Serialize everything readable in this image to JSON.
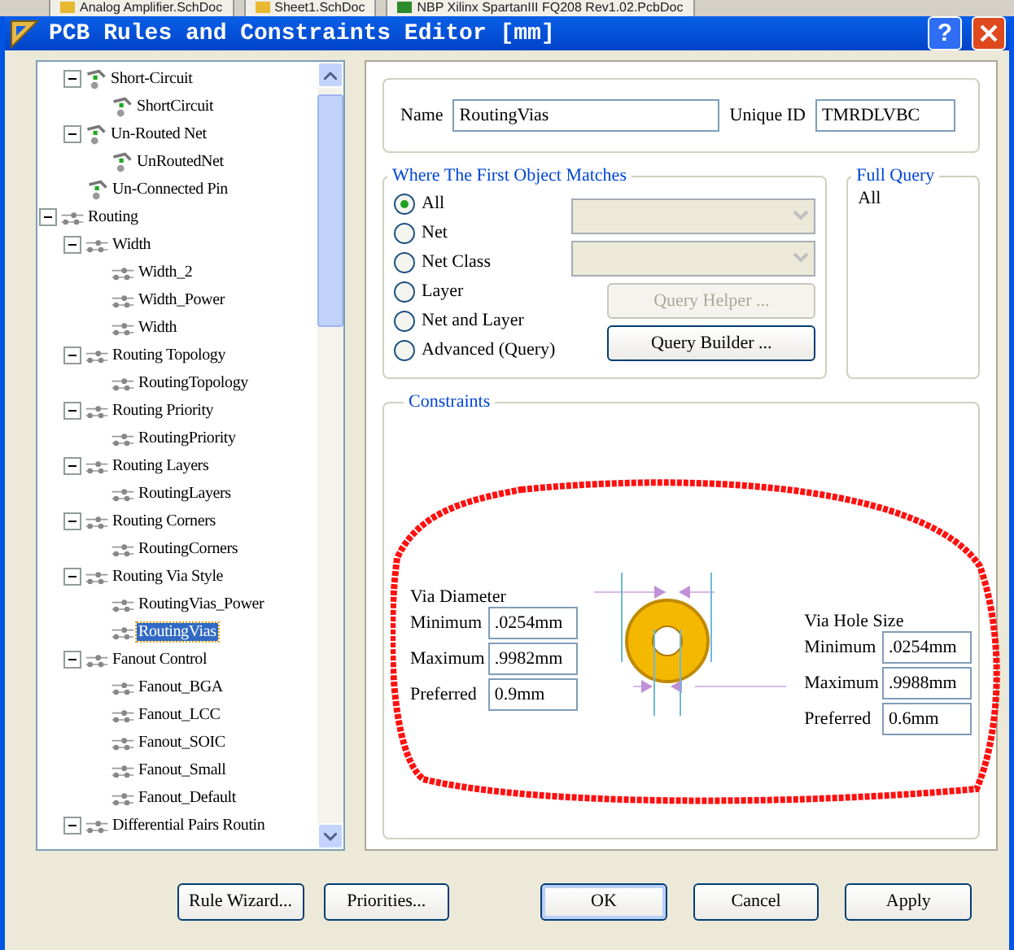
{
  "background_tabs": [
    {
      "label": "Analog Amplifier.SchDoc",
      "kind": "schematic"
    },
    {
      "label": "Sheet1.SchDoc",
      "kind": "schematic"
    },
    {
      "label": "NBP Xilinx SpartanIII FQ208 Rev1.02.PcbDoc",
      "kind": "pcb"
    }
  ],
  "window": {
    "title": "PCB Rules and Constraints Editor [mm]",
    "help": "?"
  },
  "tree": {
    "scrolled_group": [
      {
        "label": "Short-Circuit",
        "kind": "electrical",
        "expanded": true,
        "selected": false,
        "children": [
          {
            "label": "ShortCircuit",
            "kind": "electrical",
            "selected": false
          }
        ]
      },
      {
        "label": "Un-Routed Net",
        "kind": "electrical",
        "expanded": true,
        "selected": false,
        "children": [
          {
            "label": "UnRoutedNet",
            "kind": "electrical",
            "selected": false
          }
        ]
      },
      {
        "label": "Un-Connected Pin",
        "kind": "electrical",
        "selected": false
      }
    ],
    "items": [
      {
        "label": "Routing",
        "kind": "routing",
        "expanded": true,
        "selected": false,
        "children": [
          {
            "label": "Width",
            "kind": "routing",
            "expanded": true,
            "selected": false,
            "children": [
              {
                "label": "Width_2",
                "kind": "routing",
                "selected": false
              },
              {
                "label": "Width_Power",
                "kind": "routing",
                "selected": false
              },
              {
                "label": "Width",
                "kind": "routing",
                "selected": false
              }
            ]
          },
          {
            "label": "Routing Topology",
            "kind": "routing",
            "expanded": true,
            "selected": false,
            "children": [
              {
                "label": "RoutingTopology",
                "kind": "routing",
                "selected": false
              }
            ]
          },
          {
            "label": "Routing Priority",
            "kind": "routing",
            "expanded": true,
            "selected": false,
            "children": [
              {
                "label": "RoutingPriority",
                "kind": "routing",
                "selected": false
              }
            ]
          },
          {
            "label": "Routing Layers",
            "kind": "routing",
            "expanded": true,
            "selected": false,
            "children": [
              {
                "label": "RoutingLayers",
                "kind": "routing",
                "selected": false
              }
            ]
          },
          {
            "label": "Routing Corners",
            "kind": "routing",
            "expanded": true,
            "selected": false,
            "children": [
              {
                "label": "RoutingCorners",
                "kind": "routing",
                "selected": false
              }
            ]
          },
          {
            "label": "Routing Via Style",
            "kind": "routing",
            "expanded": true,
            "selected": false,
            "children": [
              {
                "label": "RoutingVias_Power",
                "kind": "routing",
                "selected": false
              },
              {
                "label": "RoutingVias",
                "kind": "routing",
                "selected": true
              }
            ]
          },
          {
            "label": "Fanout Control",
            "kind": "routing",
            "expanded": true,
            "selected": false,
            "children": [
              {
                "label": "Fanout_BGA",
                "kind": "routing",
                "selected": false
              },
              {
                "label": "Fanout_LCC",
                "kind": "routing",
                "selected": false
              },
              {
                "label": "Fanout_SOIC",
                "kind": "routing",
                "selected": false
              },
              {
                "label": "Fanout_Small",
                "kind": "routing",
                "selected": false
              },
              {
                "label": "Fanout_Default",
                "kind": "routing",
                "selected": false
              }
            ]
          },
          {
            "label": "Differential Pairs Routin",
            "kind": "routing",
            "expanded": true,
            "selected": false
          }
        ]
      }
    ]
  },
  "rule": {
    "name_label": "Name",
    "name": "RoutingVias",
    "id_label": "Unique ID",
    "id": "TMRDLVBC"
  },
  "match": {
    "title": "Where The First Object Matches",
    "options": [
      {
        "label": "All",
        "selected": true
      },
      {
        "label": "Net",
        "selected": false
      },
      {
        "label": "Net Class",
        "selected": false
      },
      {
        "label": "Layer",
        "selected": false
      },
      {
        "label": "Net and Layer",
        "selected": false
      },
      {
        "label": "Advanced (Query)",
        "selected": false
      }
    ],
    "query_helper": {
      "label": "Query Helper ...",
      "disabled": true
    },
    "query_builder": {
      "label": "Query Builder ...",
      "disabled": false
    }
  },
  "full_query": {
    "title": "Full Query",
    "text": "All"
  },
  "constraints": {
    "title": "Constraints",
    "via_diameter": {
      "title": "Via Diameter",
      "rows": [
        {
          "label": "Minimum",
          "value": ".0254mm"
        },
        {
          "label": "Maximum",
          "value": ".9982mm"
        },
        {
          "label": "Preferred",
          "value": "0.9mm"
        }
      ]
    },
    "via_hole": {
      "title": "Via Hole Size",
      "rows": [
        {
          "label": "Minimum",
          "value": ".0254mm"
        },
        {
          "label": "Maximum",
          "value": ".9988mm"
        },
        {
          "label": "Preferred",
          "value": "0.6mm"
        }
      ]
    }
  },
  "buttons": [
    {
      "label": "Rule Wizard...",
      "kind": "left"
    },
    {
      "label": "Priorities...",
      "kind": "left"
    },
    {
      "label": "OK",
      "kind": "default"
    },
    {
      "label": "Cancel",
      "kind": "right"
    },
    {
      "label": "Apply",
      "kind": "right"
    }
  ]
}
